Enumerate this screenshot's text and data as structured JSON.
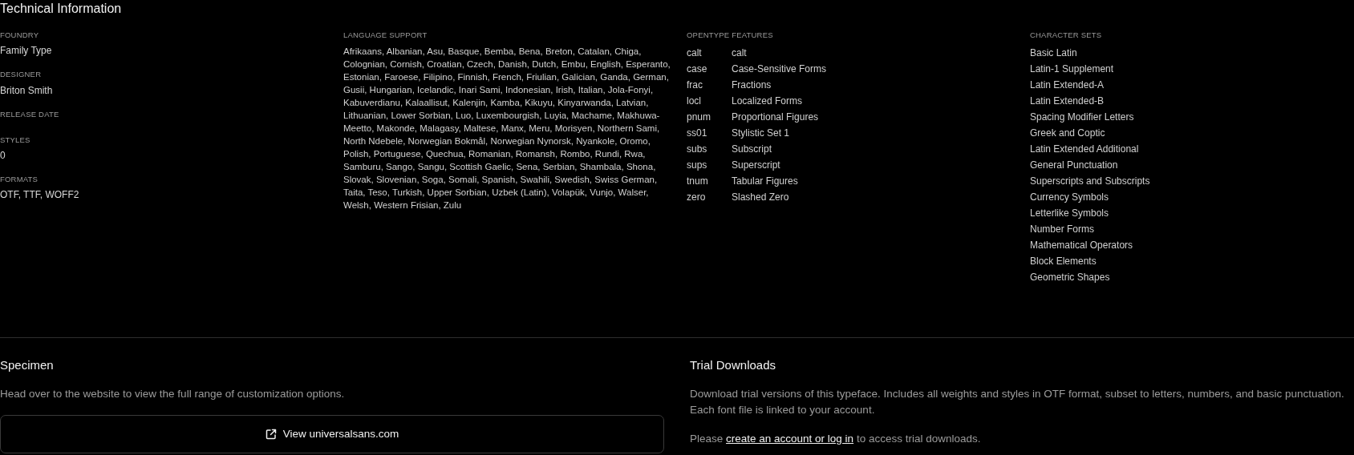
{
  "technical": {
    "title": "Technical Information",
    "details": [
      {
        "label": "FOUNDRY",
        "value": "Family Type"
      },
      {
        "label": "DESIGNER",
        "value": "Briton Smith"
      },
      {
        "label": "RELEASE DATE"
      },
      {
        "label": "STYLES",
        "value": "0"
      },
      {
        "label": "FORMATS",
        "value": "OTF, TTF, WOFF2"
      }
    ],
    "language_support": {
      "label": "LANGUAGE SUPPORT",
      "text": "Afrikaans, Albanian, Asu, Basque, Bemba, Bena, Breton, Catalan, Chiga, Colognian, Cornish, Croatian, Czech, Danish, Dutch, Embu, English, Esperanto, Estonian, Faroese, Filipino, Finnish, French, Friulian, Galician, Ganda, German, Gusii, Hungarian, Icelandic, Inari Sami, Indonesian, Irish, Italian, Jola-Fonyi, Kabuverdianu, Kalaallisut, Kalenjin, Kamba, Kikuyu, Kinyarwanda, Latvian, Lithuanian, Lower Sorbian, Luo, Luxembourgish, Luyia, Machame, Makhuwa-Meetto, Makonde, Malagasy, Maltese, Manx, Meru, Morisyen, Northern Sami, North Ndebele, Norwegian Bokmål, Norwegian Nynorsk, Nyankole, Oromo, Polish, Portuguese, Quechua, Romanian, Romansh, Rombo, Rundi, Rwa, Samburu, Sango, Sangu, Scottish Gaelic, Sena, Serbian, Shambala, Shona, Slovak, Slovenian, Soga, Somali, Spanish, Swahili, Swedish, Swiss German, Taita, Teso, Turkish, Upper Sorbian, Uzbek (Latin), Volapük, Vunjo, Walser, Welsh, Western Frisian, Zulu"
    },
    "opentype_features": {
      "label": "OPENTYPE FEATURES",
      "items": [
        {
          "tag": "calt",
          "name": "calt"
        },
        {
          "tag": "case",
          "name": "Case-Sensitive Forms"
        },
        {
          "tag": "frac",
          "name": "Fractions"
        },
        {
          "tag": "locl",
          "name": "Localized Forms"
        },
        {
          "tag": "pnum",
          "name": "Proportional Figures"
        },
        {
          "tag": "ss01",
          "name": "Stylistic Set 1"
        },
        {
          "tag": "subs",
          "name": "Subscript"
        },
        {
          "tag": "sups",
          "name": "Superscript"
        },
        {
          "tag": "tnum",
          "name": "Tabular Figures"
        },
        {
          "tag": "zero",
          "name": "Slashed Zero"
        }
      ]
    },
    "character_sets": {
      "label": "CHARACTER SETS",
      "items": [
        "Basic Latin",
        "Latin-1 Supplement",
        "Latin Extended-A",
        "Latin Extended-B",
        "Spacing Modifier Letters",
        "Greek and Coptic",
        "Latin Extended Additional",
        "General Punctuation",
        "Superscripts and Subscripts",
        "Currency Symbols",
        "Letterlike Symbols",
        "Number Forms",
        "Mathematical Operators",
        "Block Elements",
        "Geometric Shapes"
      ]
    }
  },
  "specimen": {
    "title": "Specimen",
    "text": "Head over to the website to view the full range of customization options.",
    "button": "View universalsans.com"
  },
  "trial_downloads": {
    "title": "Trial Downloads",
    "text": "Download trial versions of this typeface. Includes all weights and styles in OTF format, subset to letters, numbers, and basic punctuation. Each font file is linked to your account.",
    "notice": {
      "prefix": "Please ",
      "link": "create an account or log in",
      "suffix": " to access trial downloads."
    }
  }
}
